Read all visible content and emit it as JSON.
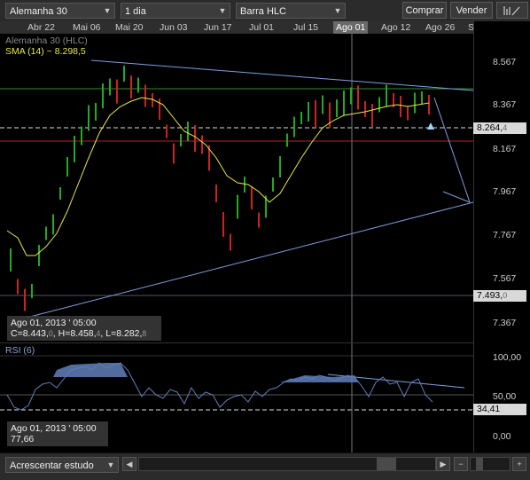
{
  "toolbar": {
    "instrument": "Alemanha 30",
    "interval": "1 dia",
    "chart_type": "Barra HLC",
    "buy_label": "Comprar",
    "sell_label": "Vender"
  },
  "date_axis": [
    "Abr 22",
    "Mai 06",
    "Mai 20",
    "Jun 03",
    "Jun 17",
    "Jul 01",
    "Jul 15",
    "Ago 01",
    "Ago 12",
    "Ago 26",
    "S"
  ],
  "legend": {
    "instrument_label": "Alemanha 30 (HLC)",
    "sma_label": "SMA (14) ~ 8.298,5",
    "rsi_label": "RSI (6)"
  },
  "price_axis": [
    "8.567",
    "8.367",
    "8.167",
    "7.967",
    "7.767",
    "7.567",
    "7.367"
  ],
  "price_tags": {
    "current": "8.264,",
    "current_sub": "4",
    "low": "7.493,",
    "low_sub": "0"
  },
  "cursor_info": {
    "date": "Ago 01, 2013 ' 05:00",
    "c": "C=8.443,",
    "c_sub": "0",
    "h": ", H=8.458,",
    "h_sub": "4",
    "l": ", L=8.282,",
    "l_sub": "8"
  },
  "rsi_axis": [
    "100,00",
    "50,00",
    "0,00"
  ],
  "rsi_tag": "34,41",
  "rsi_info": {
    "date": "Ago 01, 2013 ' 05:00",
    "value": "77,66"
  },
  "status": {
    "add_study": "Acrescentar estudo"
  },
  "colors": {
    "up": "#22aa22",
    "down": "#cc2222",
    "sma": "#e8e84a",
    "rsi": "#5f7fb8",
    "trend": "#7f9fe0"
  }
}
